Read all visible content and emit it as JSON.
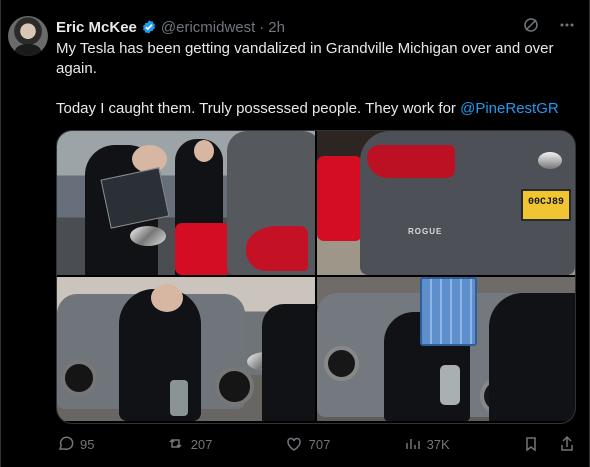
{
  "author": {
    "name": "Eric McKee",
    "handle": "@ericmidwest",
    "separator": "·",
    "time": "2h"
  },
  "text": {
    "line1": "My Tesla has been getting vandalized in Grandville Michigan over and over again.",
    "line2": "Today I caught them. Truly possessed people.  They work for ",
    "mention": "@PineRestGR"
  },
  "media": {
    "plate_text": "00CJ89",
    "vehicle_label": "ROGUE"
  },
  "actions": {
    "replies": "95",
    "reposts": "207",
    "likes": "707",
    "views": "37K"
  },
  "icons": {
    "verified": "verified-badge-icon",
    "grok": "grok-icon",
    "more": "more-icon",
    "reply": "reply-icon",
    "repost": "repost-icon",
    "like": "like-icon",
    "views": "views-icon",
    "bookmark": "bookmark-icon",
    "share": "share-icon"
  },
  "colors": {
    "accent": "#1d9bf0",
    "text": "#e7e9ea",
    "muted": "#71767b",
    "border": "#2f3336"
  }
}
